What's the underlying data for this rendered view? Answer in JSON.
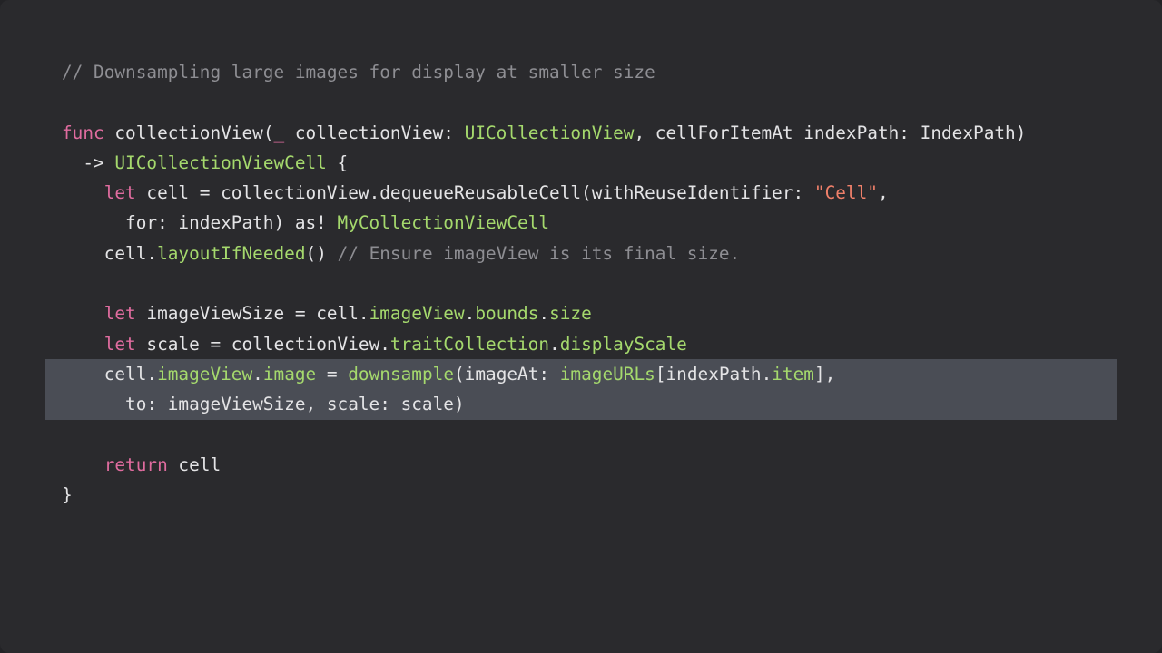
{
  "colors": {
    "background": "#2a2a2d",
    "keyword": "#e06c9f",
    "type": "#a5d96d",
    "string": "#f0806a",
    "comment": "#8e8e93",
    "text": "#e4e4e6",
    "highlight": "#4a4d55"
  },
  "code": {
    "highlighted_lines": [
      10,
      11
    ],
    "lines": [
      [
        {
          "t": "cmt",
          "s": "// Downsampling large images for display at smaller size"
        }
      ],
      [],
      [
        {
          "t": "kw",
          "s": "func"
        },
        {
          "t": "plain",
          "s": " collectionView("
        },
        {
          "t": "kw",
          "s": "_"
        },
        {
          "t": "plain",
          "s": " collectionView: "
        },
        {
          "t": "type",
          "s": "UICollectionView"
        },
        {
          "t": "plain",
          "s": ", cellForItemAt indexPath: IndexPath)"
        }
      ],
      [
        {
          "t": "plain",
          "s": "  -> "
        },
        {
          "t": "type",
          "s": "UICollectionViewCell"
        },
        {
          "t": "plain",
          "s": " {"
        }
      ],
      [
        {
          "t": "plain",
          "s": "    "
        },
        {
          "t": "kw",
          "s": "let"
        },
        {
          "t": "plain",
          "s": " cell = collectionView.dequeueReusableCell(withReuseIdentifier: "
        },
        {
          "t": "str",
          "s": "\"Cell\""
        },
        {
          "t": "plain",
          "s": ","
        }
      ],
      [
        {
          "t": "plain",
          "s": "      for: indexPath) as! "
        },
        {
          "t": "type",
          "s": "MyCollectionViewCell"
        }
      ],
      [
        {
          "t": "plain",
          "s": "    cell."
        },
        {
          "t": "fn",
          "s": "layoutIfNeeded"
        },
        {
          "t": "plain",
          "s": "() "
        },
        {
          "t": "cmt",
          "s": "// Ensure imageView is its final size."
        }
      ],
      [],
      [
        {
          "t": "plain",
          "s": "    "
        },
        {
          "t": "kw",
          "s": "let"
        },
        {
          "t": "plain",
          "s": " imageViewSize = cell."
        },
        {
          "t": "fn",
          "s": "imageView"
        },
        {
          "t": "plain",
          "s": "."
        },
        {
          "t": "fn",
          "s": "bounds"
        },
        {
          "t": "plain",
          "s": "."
        },
        {
          "t": "fn",
          "s": "size"
        }
      ],
      [
        {
          "t": "plain",
          "s": "    "
        },
        {
          "t": "kw",
          "s": "let"
        },
        {
          "t": "plain",
          "s": " scale = collectionView."
        },
        {
          "t": "fn",
          "s": "traitCollection"
        },
        {
          "t": "plain",
          "s": "."
        },
        {
          "t": "fn",
          "s": "displayScale"
        }
      ],
      [
        {
          "t": "plain",
          "s": "    cell."
        },
        {
          "t": "fn",
          "s": "imageView"
        },
        {
          "t": "plain",
          "s": "."
        },
        {
          "t": "fn",
          "s": "image"
        },
        {
          "t": "plain",
          "s": " = "
        },
        {
          "t": "fn",
          "s": "downsample"
        },
        {
          "t": "plain",
          "s": "(imageAt: "
        },
        {
          "t": "fn",
          "s": "imageURLs"
        },
        {
          "t": "plain",
          "s": "[indexPath."
        },
        {
          "t": "fn",
          "s": "item"
        },
        {
          "t": "plain",
          "s": "],"
        }
      ],
      [
        {
          "t": "plain",
          "s": "      to: imageViewSize, scale: scale)"
        }
      ],
      [],
      [
        {
          "t": "plain",
          "s": "    "
        },
        {
          "t": "kw",
          "s": "return"
        },
        {
          "t": "plain",
          "s": " cell"
        }
      ],
      [
        {
          "t": "plain",
          "s": "}"
        }
      ]
    ]
  }
}
